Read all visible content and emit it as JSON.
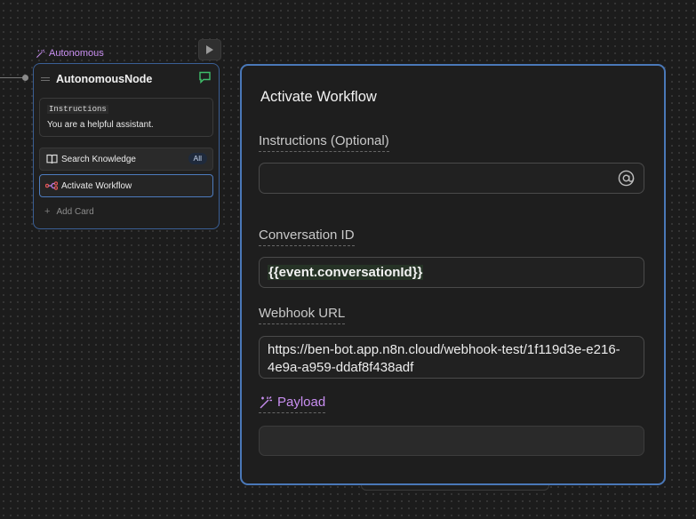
{
  "node": {
    "tag": "Autonomous",
    "title": "AutonomousNode",
    "instructions_label": "Instructions",
    "instructions_text": "You are a helpful assistant.",
    "cards": [
      {
        "label": "Search Knowledge",
        "badge": "All"
      },
      {
        "label": "Activate Workflow"
      }
    ],
    "add_card_label": "Add Card"
  },
  "panel": {
    "title": "Activate Workflow",
    "fields": {
      "instructions": {
        "label": "Instructions (Optional)",
        "value": ""
      },
      "conversation_id": {
        "label": "Conversation ID",
        "value": "{{event.conversationId}}"
      },
      "webhook_url": {
        "label": "Webhook URL",
        "value": "https://ben-bot.app.n8n.cloud/webhook-test/1f119d3e-e216-4e9a-a959-ddaf8f438adf"
      },
      "payload": {
        "label": "Payload",
        "value": ""
      }
    }
  },
  "colors": {
    "canvas_bg": "#1c1c1c",
    "accent_blue": "#4a78b8",
    "accent_purple": "#c88ef0",
    "chat_icon_green": "#3fbf6a"
  },
  "icons": [
    "magic-wand-icon",
    "play-icon",
    "drag-handle-icon",
    "chat-icon",
    "book-icon",
    "workflow-icon",
    "plus-icon",
    "at-icon"
  ]
}
